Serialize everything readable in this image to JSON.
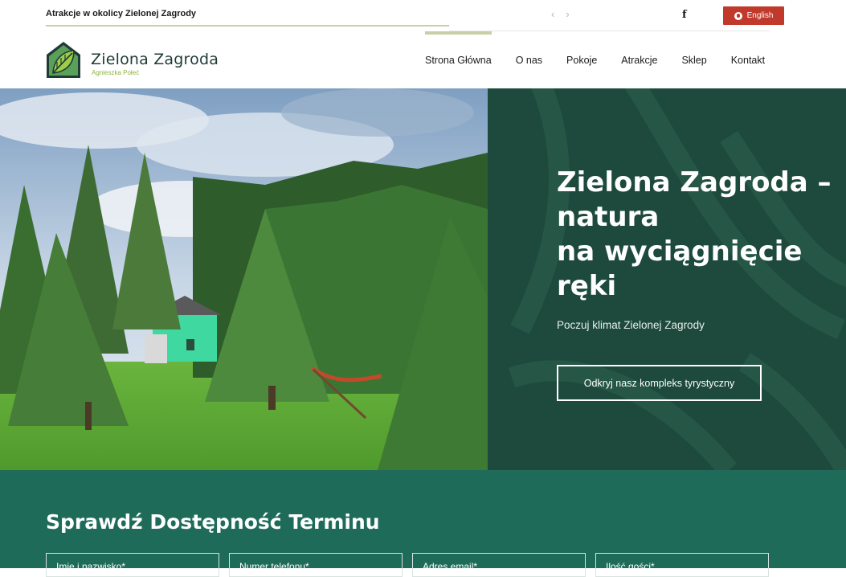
{
  "topbar": {
    "ticker_text": "Atrakcje w okolicy Zielonej Zagrody",
    "prev_arrow": "‹",
    "next_arrow": "›",
    "facebook_label": "f",
    "language_label": "English",
    "language_color": "#c0392b"
  },
  "brand": {
    "name": "Zielona Zagroda",
    "owner": "Agnieszka Połeć",
    "logo_icon": "leaf-house-icon"
  },
  "nav": {
    "items": [
      {
        "label": "Strona Główna",
        "active": true
      },
      {
        "label": "O nas",
        "active": false
      },
      {
        "label": "Pokoje",
        "active": false
      },
      {
        "label": "Atrakcje",
        "active": false
      },
      {
        "label": "Sklep",
        "active": false
      },
      {
        "label": "Kontakt",
        "active": false
      }
    ]
  },
  "hero": {
    "title_lines": [
      "Zielona Zagroda –",
      "natura",
      "na wyciągnięcie",
      "ręki"
    ],
    "subtitle": "Poczuj klimat Zielonej Zagrody",
    "cta_label": "Odkryj nasz kompleks tyrystyczny",
    "panel_color": "#1d4a3c"
  },
  "booking": {
    "heading": "Sprawdź Dostępność Terminu",
    "fields": [
      "Imię i nazwisko*",
      "Numer telefonu*",
      "Adres email*",
      "Ilość gości*"
    ],
    "background_color": "#1f6b5a"
  }
}
